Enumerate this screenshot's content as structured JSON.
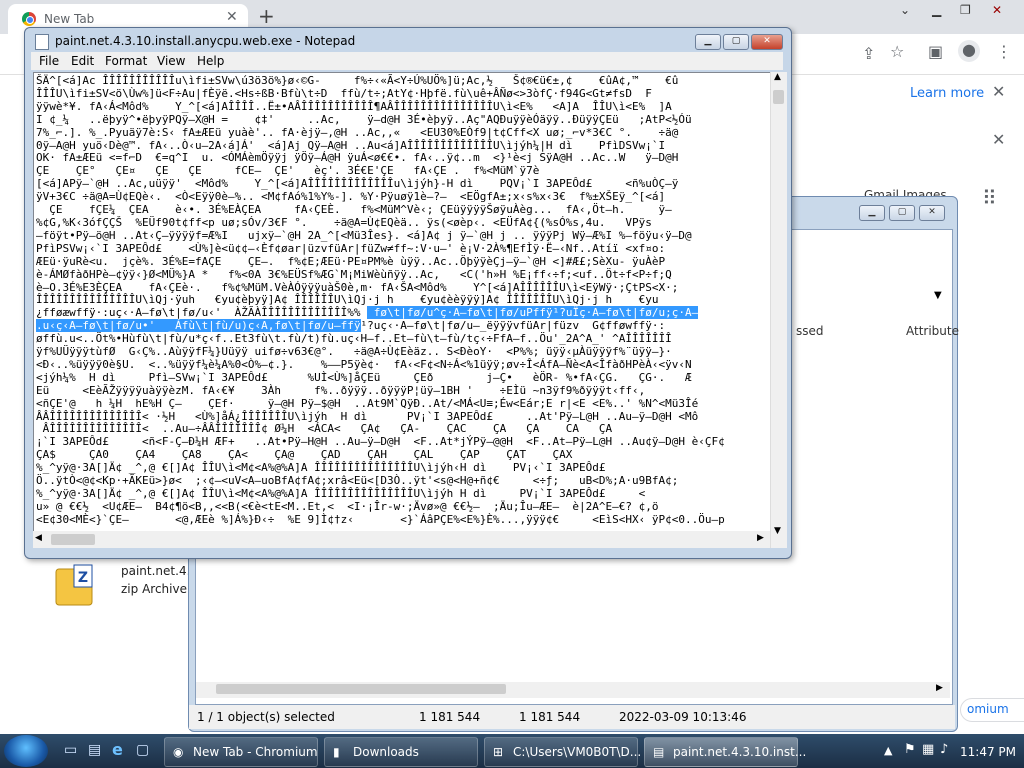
{
  "chrome": {
    "tab_title": "New Tab",
    "new_tab_glyph": "+",
    "learn_more": "Learn more",
    "gmail_images": "Gmail   Images",
    "chromium_link": "omium"
  },
  "explorer": {
    "header_cols": [
      "ssed",
      "Attribute"
    ],
    "status": {
      "selected": "1 / 1 object(s) selected",
      "size1": "1 181 544",
      "size2": "1 181 544",
      "date": "2022-03-09 10:13:46"
    },
    "zip_item": {
      "name": "paint.net.4.3",
      "type": "zip Archive"
    }
  },
  "notepad": {
    "title": "paint.net.4.3.10.install.anycpu.web.exe - Notepad",
    "menu": [
      "File",
      "Edit",
      "Format",
      "View",
      "Help"
    ],
    "lines_before": [
      "ŠÄ^[<á]Ac ÎÎÎÎÎÎÎÎÎÎÎu\\ìfi±SVw\\ú3ö3ö%}ø‹©G-     f%÷‹«Ã<Y÷Ú%UÖ%]ü;Ac,½   Š¢®€ü€±,¢    €ûA¢,™    €û",
      "ÎÎÎU\\ìfi±SV<ö\\Ùw%]ü<F÷Au|fÈÿë.<Hs÷ßB·Bfù\\t÷D  ffù/t÷;AtY¢·Hþfë.fù\\uê+ÂÑø<>3òfÇ·f94G<Gt≠fsD  F",
      "ÿÿwè*¥. fA‹Á<Môd%    Y_^[<á]AÎÎÎÎ..Ë±•AÂÎÎÎÎÎÎÎÎÎÎÎ¶AÂÎÎÎÎÎÎÎÎÎÎÎÎÎÎÎU\\ì<E%   <A]A  ÎÎU\\ì<E%  ]A",
      "I ¢_¼   ..ëþyÿ^•ëþyÿPQÿ–X@H =    ¢‡'     ..Ac,    ÿ–d@H 3É•èþyÿ..Aç\"AQÐuÿÿèÓäÿÿ..ÐüÿÿÇEü   ;AtP<½Óü",
      "7%_⌐.]. %_.Pyuäÿ7è:S‹ fA±ÆEü yuàè'.. fA·èjÿ–,@H ..Ac,,«   <EU30%EÒf9|t¢Cff<X uø;_⌐v*3€C °.    ÷ä@",
      "0ÿ–A@H yuö‹Dè@™. fA‹..Ò‹u–2A‹á]Á'  <á]Aj Qÿ–A@H ..Au<á]AÎÎÎÎÎÎÎÎÎÎÎÎÎU\\ìjýh¼|H dì    PfìDSVw¡`I",
      "OK· fA±ÆEü <=f⌐D  €=q^I  u. <ÓMÁèmÖÿÿj ÿÖÿ–Á@H ÿuÁ<ø€€•. fA‹..ÿ¢..m  <}¹è<j SÿA@H ..Ac..W   ÿ–D@H",
      "ÇE    ÇE°   ÇE¤   ÇE   ÇE     fCE–  ÇE'   èç'. 3É€E'ÇE   fA‹ÇE .  f%<MüM`ÿ7è",
      "[<á]APÿ–`@H ..Ac,uüÿÿ'  <Môd%    Y_^[<á]AÎÎÎÎÎÎÎÎÎÎÎÎÎu\\ìjýh}-H dì    PQV¡`I 3APEÔd£     <ñ%uÒÇ–ÿ",
      "ÿV+3€C ÷ä@A=Ù¢EQè‹.  <Ò<Eÿÿ0è–%.. <M¢fAó%1%Y%-]. %Y·Pÿuøÿ1è–?–  <EÖgfA±;x‹s%x‹3€  f%±XŠEÿ_^[<á]",
      "  ÇE    fÇE¼  ÇEA    è‹•. 3É%EÀÇEA     fA‹ÇEÈ.   f%<MüM^Vè‹; ÇEüÿÿÿÿŠøÿuÀèg...  fA‹,Öt–h.     ÿ–",
      "%¢G,%K‹3ófÇÇŠ  %EÜf90t¢ff<p uø;sÓv/3€F °.    ÷ä@A=Ù¢EQèä.. ÿs(<øèp‹. <EÜfA¢{(%sÓ%s,4u.   VPÿs",
      "–föÿt•Pÿ–ö@H ..At‹Ç–ÿÿÿÿf=Æ%I   ujxÿ–`@H 2A_^[<Mü3Îes}. <á]A¢ j ÿ–`@H j .. ÿÿÿPj Wÿ–Æ%I %–föÿu‹ÿ–D@",
      "PfìPSVw¡‹`I 3APEÔd£    <Ù%]è<ü¢¢–‹Èf¢øar|üzvfüAr|füZw≠ff~:V·u–' è¡V·2À%¶EfÌÿ·Ë–‹Nf..Atíï <xf¤o:",
      "ÆEü·ÿuRè<u.  jçè%. 3É%E=fAÇE    ÇE–.  f%¢E;ÆEü·PE¤PM%è ùÿÿ..Ac..ÖþÿÿèÇj–ÿ–`@H <]#Æ£;SèXu- ÿuÀèP",
      "è-ÁMØfàðHPè–¢ÿÿ‹}Ø<MÜ%}A *   f%<0A 3€%EÜSf%ÆG`M¡MiWèùñÿÿ..Ac,   <C('h»H %E¡ff‹÷f;<uf..Öt÷f<P÷f;Q",
      "è–O.3É%E3ÈÇEA    fA‹ÇEè·.   f%¢%MüM.VèÀÓÿÿÿuàŠ0è,m· fA‹ŠA<Môd%    Y^[<á]AÎÎÎÎÎÎU\\ì<EÿWÿ·;ÇtPS<X·;",
      "ÎÎÎÎÎÎÎÎÎÎÎÎÎÎÎU\\ìQj·ÿuh   €yu¢èþyÿ]A¢ ÎÎÎÎÎÎU\\ìQj·j h    €yu¢èèÿÿÿ]A¢ ÎÎÎÎÎÎÎU\\ìQj·j h    €yu"
    ],
    "line_mixed": {
      "pre": "¿fføæwffÿ·:uç‹·A–fø\\t|fø/u‹'  ÀŽÃÀÎÎÎÎÎÎÎÎÎÎÎÎÎ%% ",
      "sel": " fø\\t|fø/u^ç·A–fø\\t|fø/uPffÿ¹?uÏç·A–fø\\t|fø/u;ç·A–"
    },
    "line_selected": ".u‹ç‹A–fø\\t|fø/u•'  _Áfù\\t|fù/u)ç‹A,fø\\t|fø/u–ffÿ",
    "line_after_sel": "¹?uç‹·A–fø\\t|fø/u–_ëÿÿÿvfüAr|füzv  G¢fføwffÿ·:",
    "lines_after": [
      "øffù.u<..Öt%•Hùfù\\t|fù/u*ç‹f..Et3fù\\t.fù/t)fù.uç‹H–f..Et–fù\\t–fù/tç‹÷FfA–f..Öu'_2A^A_' ^AÎÎÎÎÎÎÎ",
      "ÿf%UÜÿÿÿtùfØ  G‹Ç%..AùÿÿfF¼}Uüÿÿ uifø÷v63€@°.   ÷ä@A÷Ù¢Eèäz.. S<ÐèoY·  <P%%; üÿÿ‹µÀüÿÿÿf%¨üÿÿ–}·",
      "<Ð‹..%üÿÿÿ0è§U.  <..%üÿÿf¼è¼A%0<Ò%–¢.}.    %–—P5ÿè¢·  fA‹<F¢<N÷Á<%1üÿÿ;øv÷Î<ÁfA–Ñè<A<ÎfàðHPèÀ‹<ÿv‹N",
      "<jýh¼%  H dì     Pfì–SVw¡`I 3APEÔd£      %UÌ<Ù%]åÇEü     ÇEð        j–Ç•   èÖR- %•fA‹ÇG.   ÇG·.   Æ",
      "Eü     <EèÃŽÿÿÿÿuàÿÿèzM. fA‹€¥    3Àh     f%..ðÿÿÿ..ðÿÿÿP¦üÿ–1BH '    ÷EÌü ~n3ÿf9%ðÿÿÿt‹ff‹,",
      "<ñÇE'@   h ¼H  hE%H Ç–    ÇEf·     ÿ–@H Pÿ–$@H  ..At9M`QÿÐ..At/<MÁ<U≡;Éw<Eár;E r|<E <E%..' %N^<Mü3Îé",
      "ÂÂÎÎÎÎÎÎÎÎÎÎÎÎÎÎ< ·½H   <Ù%]åÁ¿ÎÎÎÎÎÎÎU\\ìjýh  H dì      PV¡`I 3APEÔd£     ..At'Pÿ–L@H ..Au–ÿ–D@H <Mô",
      " ÂÎÎÎÎÎÎÎÎÎÎÎÎÎÎ<  ..Au–÷ÂÂÎÎÎÎÎÎÎ¢ Ø¼H  <ÁCA<   ÇA¢   ÇA-    ÇAC    ÇA   ÇA    CA   ÇA",
      "¡`I 3APEÔd£     <ñ<F-Ç–Ð¼H ÆF+   ..At•Pÿ–H@H ..Au–ÿ–D@H  <F..At*jÝPÿ–@@H  <F..At–Pÿ–L@H ..Au¢ÿ–D@H è‹ÇF¢",
      "ÇA$     ÇA0    ÇA4    ÇA8    ÇA<    ÇA@    ÇAD    ÇAH    ÇAL    ÇAP    ÇAT    ÇAX",
      "%_^yÿ@·3A[]Ä¢ _^,@ €[]A¢ ÎÎU\\ì<M¢<A%@%A]A ÎÎÎÎÎÎÎÎÎÎÎÎÎÎÎU\\ìjýh‹H dì    PV¡‹`I 3APEÔd£    ",
      "Ö..ÿtÒ<@¢<Kp·+ÃKEü>}ø<  ;‹¢–<uV<A–uoBfA¢fA¢;xrâ<Eü<[D3Ò..ÿt'<s@<H@+ñ¢€     <÷ƒ;   uB<D%;A·u9BfA¢;",
      "%_^yÿ@·3A[]Ä¢ _^,@ €[]A¢ ÎÎU\\ì<M¢<A%@%A]A ÎÎÎÎÎÎÎÎÎÎÎÎÎÎÎU\\ìjýh H dì     PV¡`I 3APEÔd£     <",
      "u» @ €€½  <U¢ÆE–  B4¢¶ö<B,,<<B(<€è<tE<M..Et,<  <I·¡Îr-w·;Ävø»@ €€½–  ;Äu;Îu–ÆE–  è|2A^E–€? ¢,ö",
      "<E¢30<MÈ<}`ÇE–       <@,ÆEè %]Á%}Ð‹÷  %E 9]Ì¢†z‹       <}`ÁâPÇE%<E%}È%...,ÿÿÿ¢€     <EìS<HX‹ ÿP¢<0..Öu–p"
    ]
  },
  "taskbar": {
    "items": [
      "New Tab - Chromium",
      "Downloads",
      "C:\\Users\\VM0B0T\\D...",
      "paint.net.4.3.10.inst..."
    ],
    "time": "11:47 PM"
  }
}
